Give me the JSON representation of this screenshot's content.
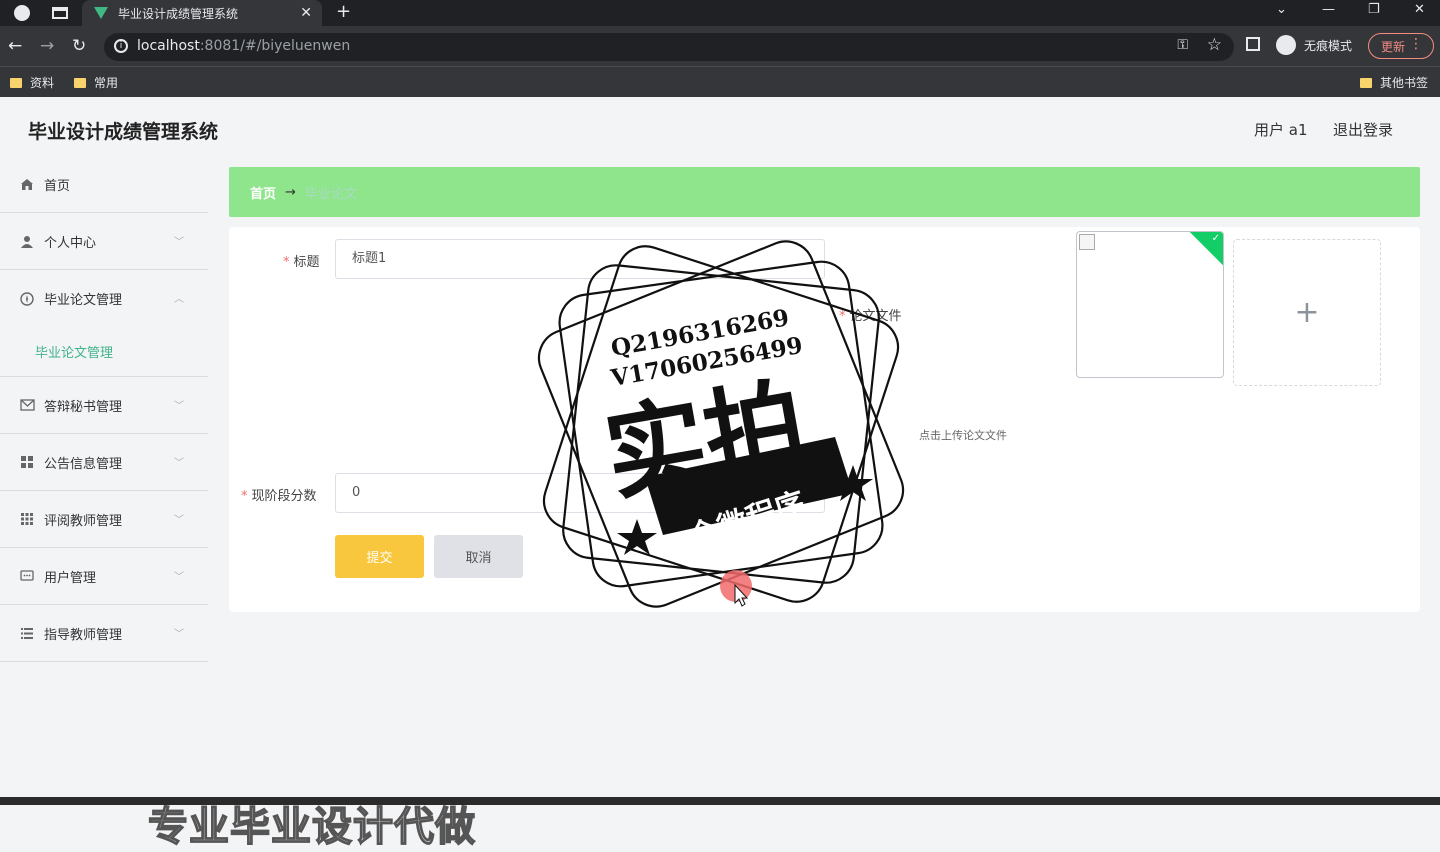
{
  "browser": {
    "tab_title": "毕业设计成绩管理系统",
    "url_host": "localhost",
    "url_rest": ":8081/#/biyeluenwen",
    "incognito_label": "无痕模式",
    "update_label": "更新",
    "bookmarks": [
      "资料",
      "常用"
    ],
    "other_bookmarks": "其他书签"
  },
  "app": {
    "title": "毕业设计成绩管理系统",
    "user_label": "用户 a1",
    "logout_label": "退出登录"
  },
  "sidebar": {
    "items": [
      {
        "label": "首页",
        "icon": "home-icon"
      },
      {
        "label": "个人中心",
        "icon": "user-icon"
      },
      {
        "label": "毕业论文管理",
        "icon": "compass-icon",
        "expanded": true,
        "sub": "毕业论文管理"
      },
      {
        "label": "答辩秘书管理",
        "icon": "mail-icon"
      },
      {
        "label": "公告信息管理",
        "icon": "grid-icon"
      },
      {
        "label": "评阅教师管理",
        "icon": "table-icon"
      },
      {
        "label": "用户管理",
        "icon": "chat-icon"
      },
      {
        "label": "指导教师管理",
        "icon": "list-icon"
      }
    ]
  },
  "breadcrumb": {
    "home": "首页",
    "arrow": "→",
    "current": "毕业论文"
  },
  "form": {
    "title_label": "标题",
    "title_value": "标题1",
    "file_label": "论文文件",
    "upload_tip": "点击上传论文文件",
    "score_label": "现阶段分数",
    "score_value": "0",
    "submit_label": "提交",
    "cancel_label": "取消",
    "uploader_plus": "+"
  },
  "overlay": {
    "stamp_line1": "Q2196316269",
    "stamp_line2": "V17060256499",
    "stamp_big": "实拍",
    "stamp_banner": "全微程序",
    "promo": "专业毕业设计代做"
  },
  "colors": {
    "accent_green": "#8ee58b",
    "submit_yellow": "#f9c73d",
    "active_text": "#41b38a"
  }
}
